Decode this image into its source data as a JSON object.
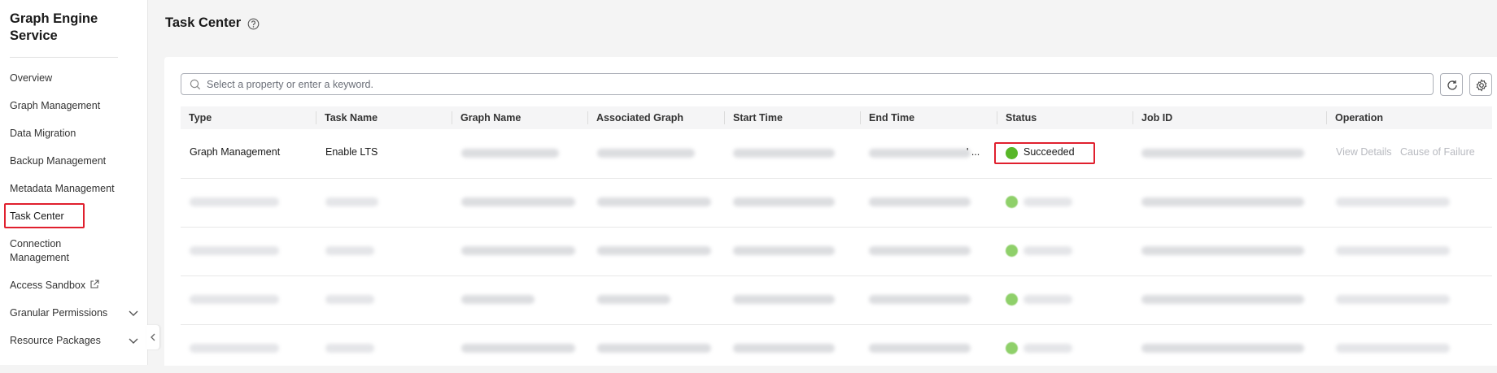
{
  "sidebar": {
    "title": "Graph Engine Service",
    "items": [
      {
        "label": "Overview"
      },
      {
        "label": "Graph Management"
      },
      {
        "label": "Data Migration"
      },
      {
        "label": "Backup Management"
      },
      {
        "label": "Metadata Management"
      },
      {
        "label": "Task Center"
      },
      {
        "label": "Connection Management"
      },
      {
        "label": "Access Sandbox"
      },
      {
        "label": "Granular Permissions"
      },
      {
        "label": "Resource Packages"
      }
    ]
  },
  "header": {
    "title": "Task Center"
  },
  "search": {
    "placeholder": "Select a property or enter a keyword."
  },
  "table": {
    "columns": [
      "Type",
      "Task Name",
      "Graph Name",
      "Associated Graph",
      "Start Time",
      "End Time",
      "Status",
      "Job ID",
      "Operation"
    ],
    "rows": [
      {
        "type": "Graph Management",
        "task_name": "Enable LTS",
        "end_time_suffix": "' ...",
        "status": "Succeeded",
        "op_view": "View Details",
        "op_cause": "Cause of Failure"
      }
    ]
  },
  "colors": {
    "accent_red": "#e0202e",
    "success_green": "#58b728"
  }
}
